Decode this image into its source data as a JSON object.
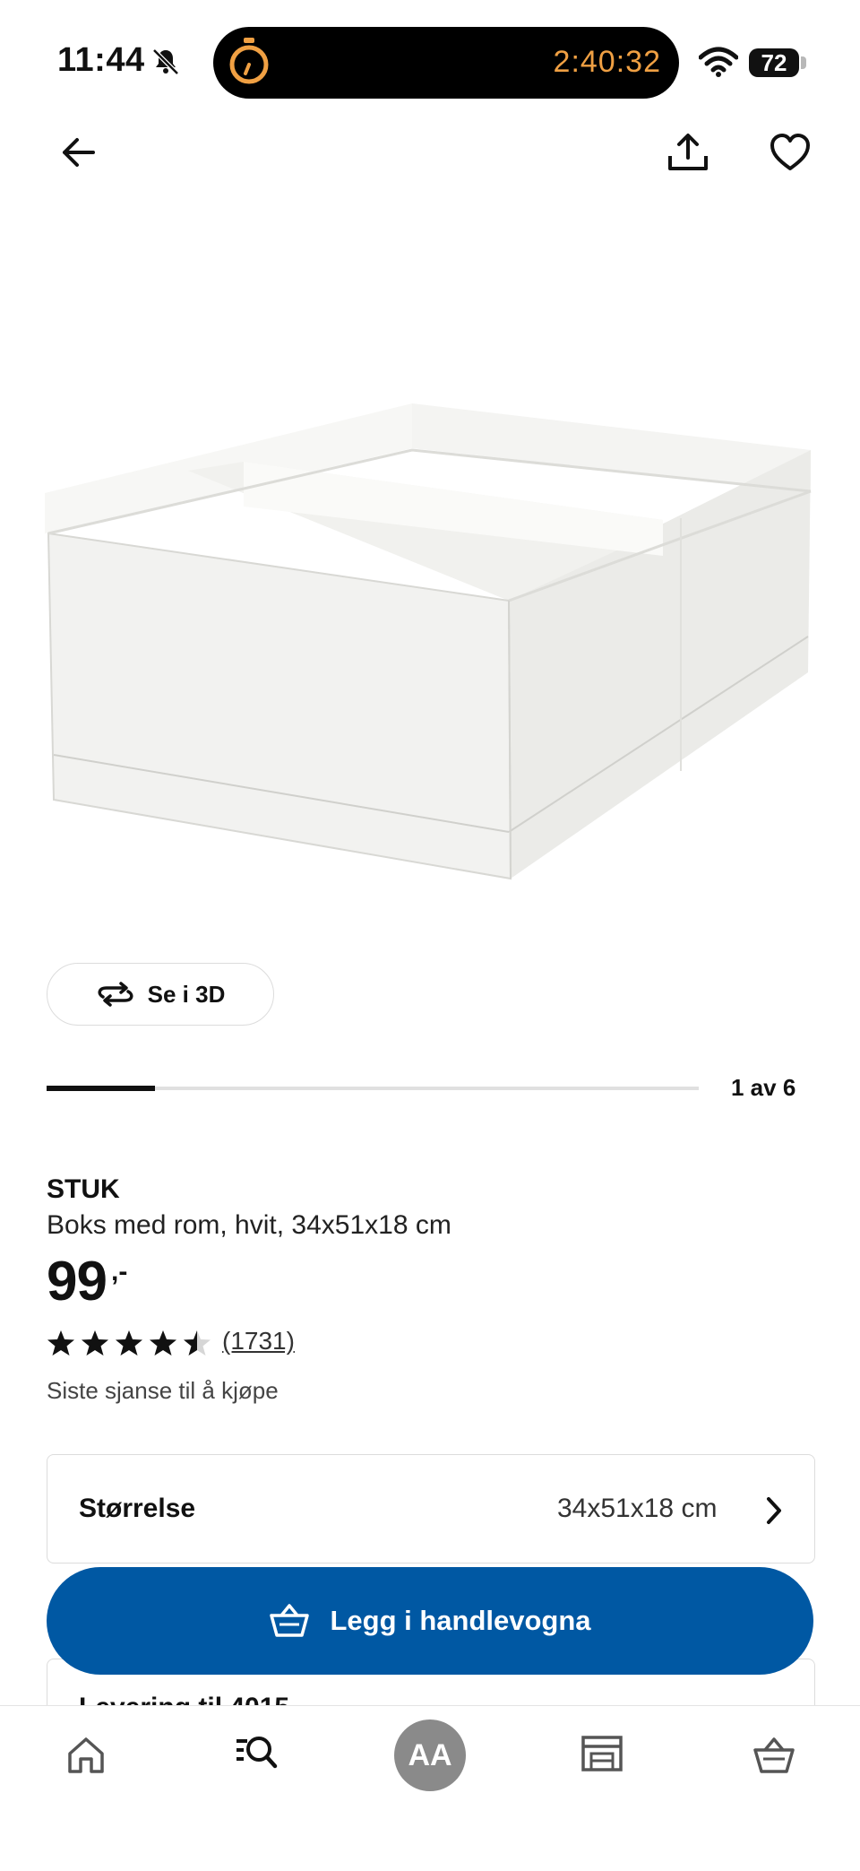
{
  "status_bar": {
    "time": "11:44",
    "timer": "2:40:32",
    "battery": "72",
    "accent_color": "#f0a043"
  },
  "nav": {
    "back_icon": "arrow-left-icon",
    "share_icon": "share-icon",
    "favorite_icon": "heart-icon"
  },
  "product": {
    "view_3d_label": "Se i 3D",
    "image_counter": "1 av 6",
    "image_progress": 0.1667,
    "brand": "STUK",
    "description": "Boks med rom, hvit, 34x51x18 cm",
    "price": "99",
    "price_suffix": ",-",
    "rating": 4.5,
    "rating_max": 5,
    "review_count": "(1731)",
    "availability": "Siste sjanse til å kjøpe"
  },
  "size_selector": {
    "label": "Størrelse",
    "value": "34x51x18 cm"
  },
  "cart_button": {
    "label": "Legg i handlevogna",
    "color": "#0058a3"
  },
  "delivery": {
    "label": "Levering til 4015"
  },
  "tabbar": {
    "items": [
      {
        "icon": "home-icon"
      },
      {
        "icon": "search-list-icon"
      },
      {
        "avatar": "AA"
      },
      {
        "icon": "store-icon"
      },
      {
        "icon": "basket-icon"
      }
    ]
  }
}
